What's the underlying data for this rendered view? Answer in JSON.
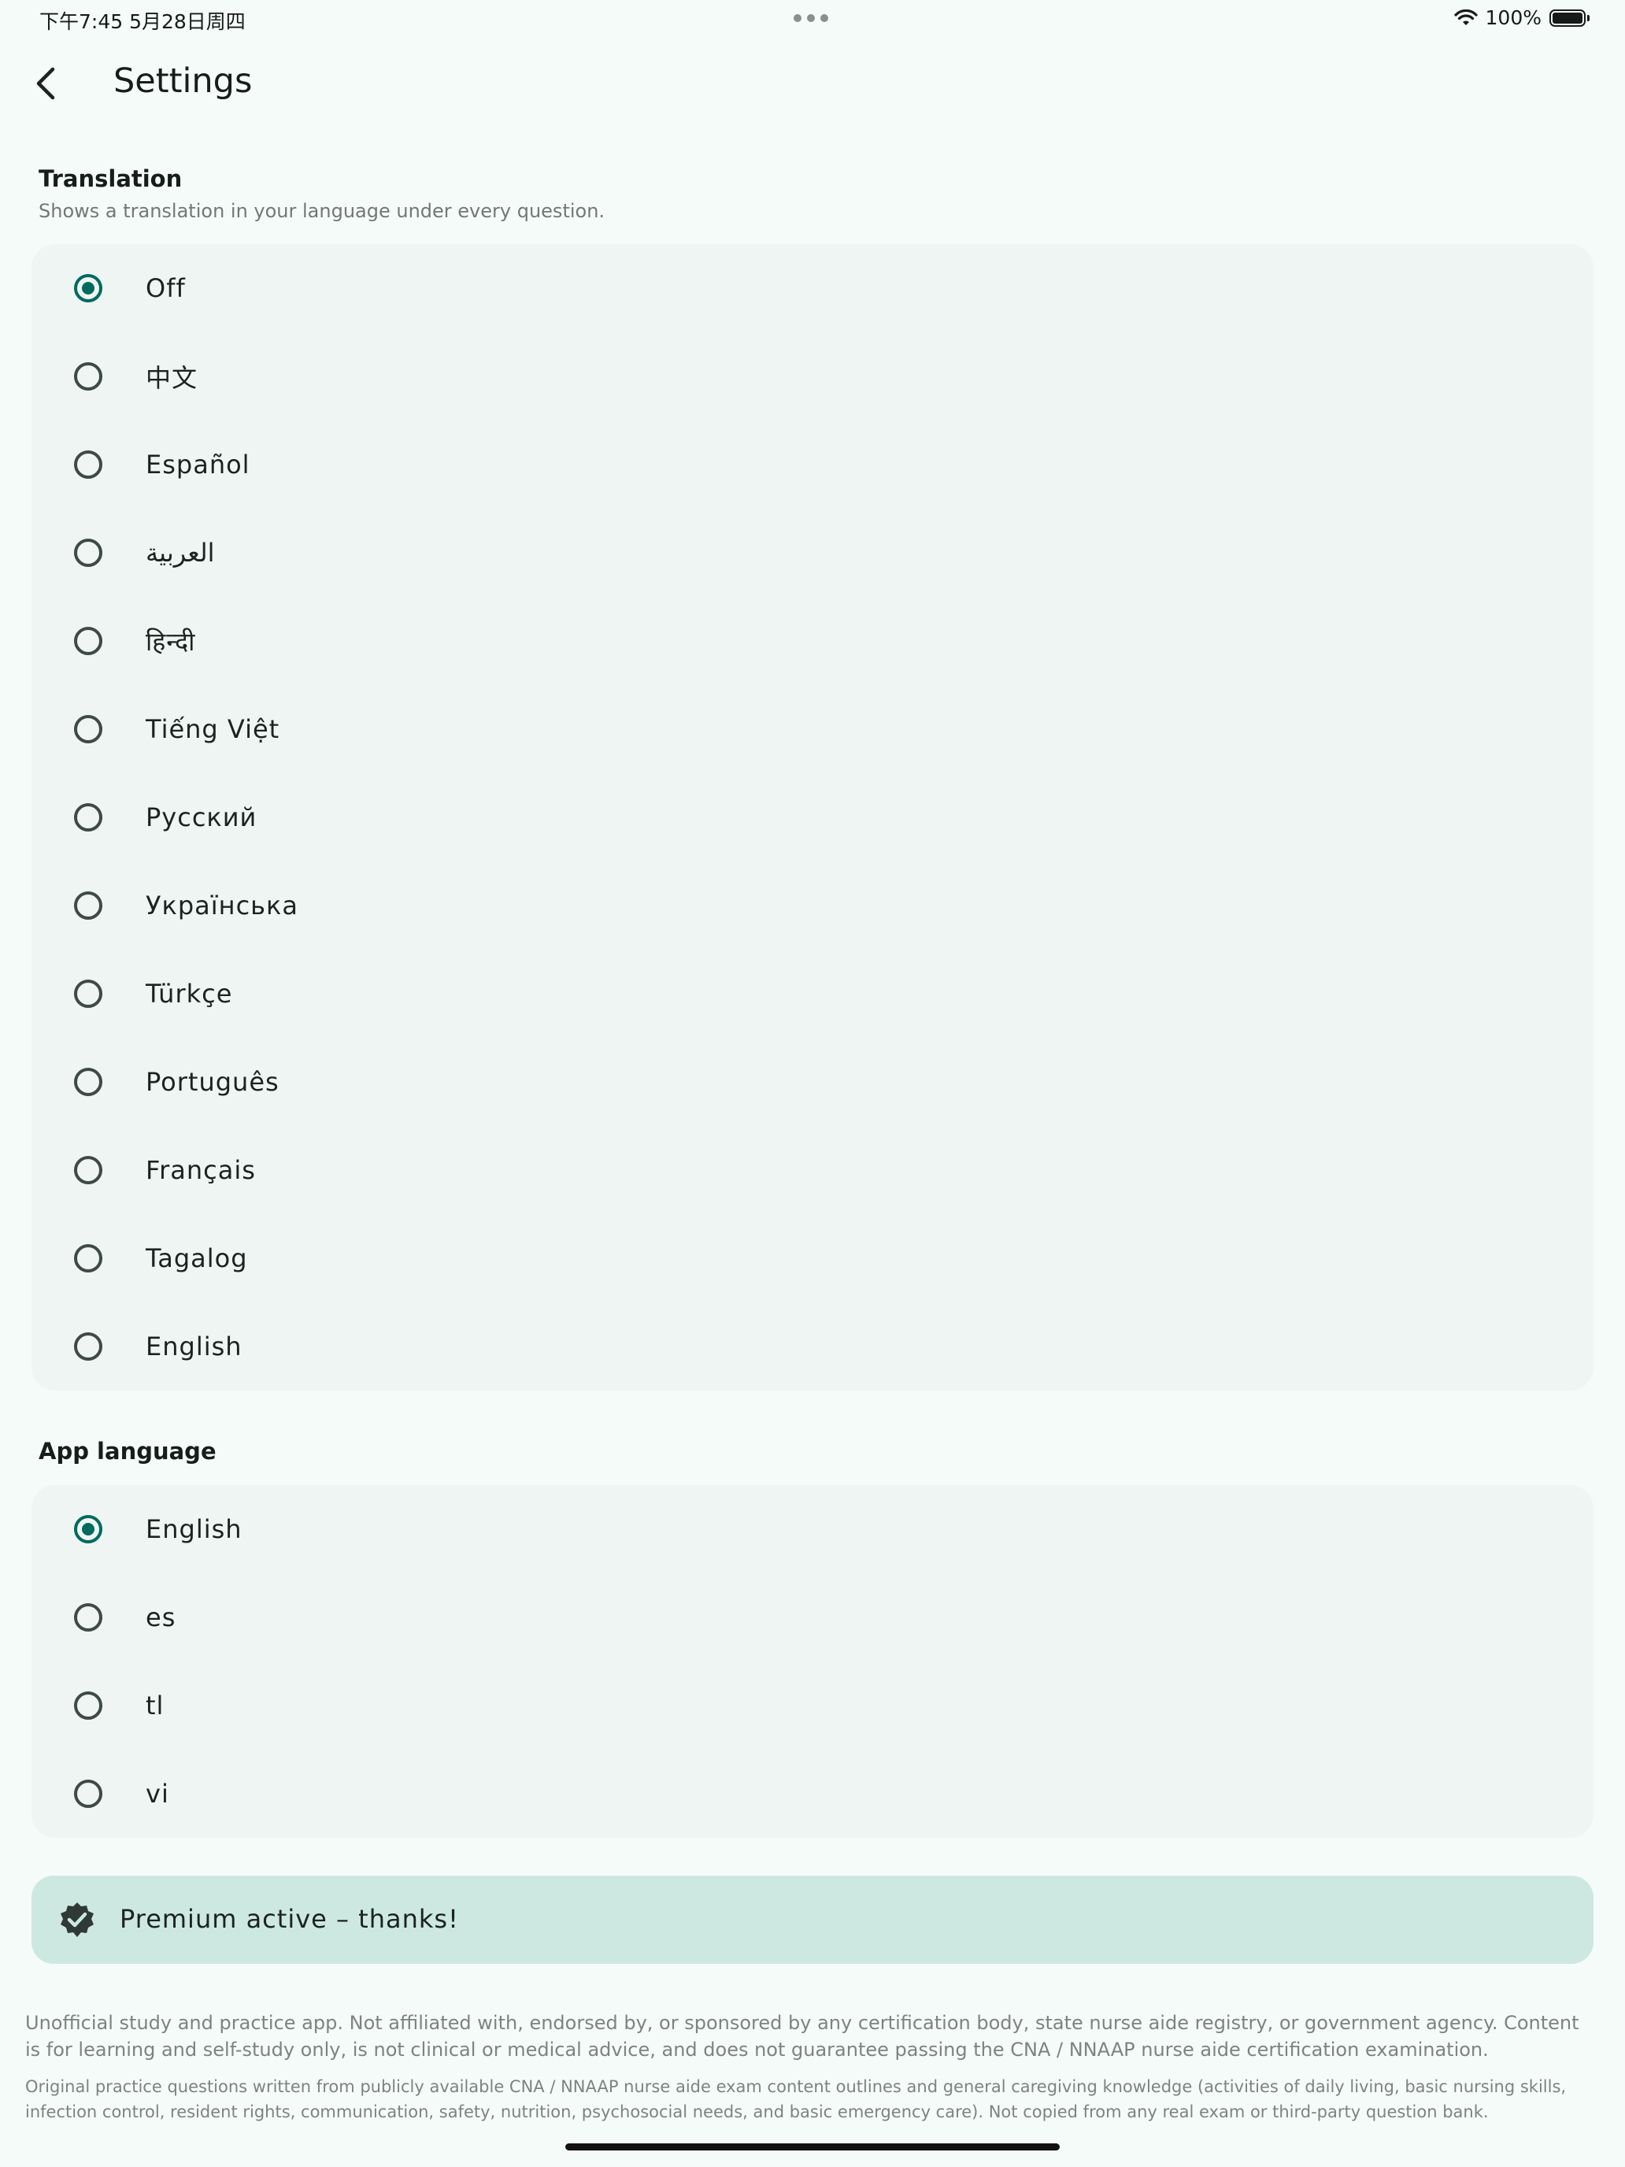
{
  "status_bar": {
    "time": "下午7:45  5月28日周四",
    "battery": "100%"
  },
  "header": {
    "title": "Settings"
  },
  "translation": {
    "title": "Translation",
    "subtitle": "Shows a translation in your language under every question.",
    "options": [
      {
        "label": "Off",
        "selected": true
      },
      {
        "label": "中文",
        "selected": false
      },
      {
        "label": "Español",
        "selected": false
      },
      {
        "label": "العربية",
        "selected": false
      },
      {
        "label": "हिन्दी",
        "selected": false
      },
      {
        "label": "Tiếng Việt",
        "selected": false
      },
      {
        "label": "Русский",
        "selected": false
      },
      {
        "label": "Українська",
        "selected": false
      },
      {
        "label": "Türkçe",
        "selected": false
      },
      {
        "label": "Português",
        "selected": false
      },
      {
        "label": "Français",
        "selected": false
      },
      {
        "label": "Tagalog",
        "selected": false
      },
      {
        "label": "English",
        "selected": false
      }
    ]
  },
  "app_language": {
    "title": "App language",
    "options": [
      {
        "label": "English",
        "selected": true
      },
      {
        "label": "es",
        "selected": false
      },
      {
        "label": "tl",
        "selected": false
      },
      {
        "label": "vi",
        "selected": false
      }
    ]
  },
  "premium": {
    "label": "Premium active – thanks!",
    "icon": "verified-badge-icon"
  },
  "disclaimer": {
    "p1": "Unofficial study and practice app. Not affiliated with, endorsed by, or sponsored by any certification body, state nurse aide registry, or government agency. Content is for learning and self-study only, is not clinical or medical advice, and does not guarantee passing the CNA / NNAAP nurse aide certification examination.",
    "p2": "Original practice questions written from publicly available CNA / NNAAP nurse aide exam content outlines and general caregiving knowledge (activities of daily living, basic nursing skills, infection control, resident rights, communication, safety, nutrition, psychosocial needs, and basic emergency care). Not copied from any real exam or third-party question bank."
  },
  "colors": {
    "accent": "#006a61",
    "background": "#f5fbf9",
    "card": "#eef5f2",
    "premium_bg": "#cde8e1"
  }
}
